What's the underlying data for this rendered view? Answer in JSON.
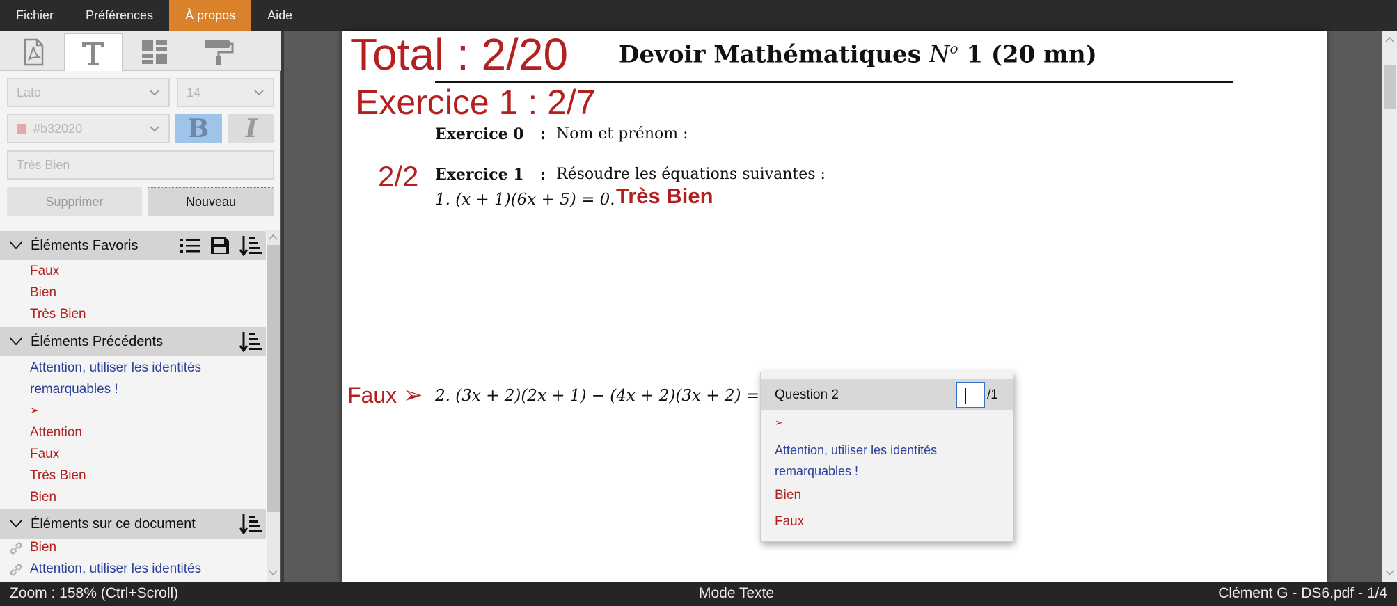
{
  "menu": {
    "file": "Fichier",
    "preferences": "Préférences",
    "about": "À propos",
    "help": "Aide"
  },
  "format": {
    "font": "Lato",
    "size": "14",
    "color": "#b32020",
    "bold_label": "B",
    "italic_label": "I",
    "text_value": "Très Bien",
    "delete_label": "Supprimer",
    "new_label": "Nouveau"
  },
  "favorites": {
    "title": "Éléments Favoris",
    "items": [
      "Faux",
      "Bien",
      "Très Bien"
    ]
  },
  "previous": {
    "title": "Éléments Précédents",
    "items": [
      "Attention, utiliser les identités remarquables !",
      "➢",
      "Attention",
      "Faux",
      "Très Bien",
      "Bien"
    ]
  },
  "document_items": {
    "title": "Éléments sur ce document",
    "items": [
      "Bien",
      "Attention, utiliser les identités"
    ]
  },
  "page": {
    "total": "Total : 2/20",
    "title": "Devoir Mathématiques",
    "title_no": "N",
    "title_o": "o",
    "title_rest": "1 (20 mn)",
    "exercise_score": "Exercice 1 : 2/7",
    "ex0_label": "Exercice 0",
    "ex0_colon": ":",
    "ex0_text": "Nom et prénom :",
    "q_score": "2/2",
    "ex1_label": "Exercice 1",
    "ex1_colon": ":",
    "ex1_text": "Résoudre les équations suivantes :",
    "eq1": "1.  (x + 1)(6x + 5) = 0.",
    "eq1_annotation": "Très Bien",
    "faux_annotation": "Faux",
    "arrow": "➢",
    "eq2": "2.  (3x + 2)(2x + 1) − (4x + 2)(3x + 2) = 0"
  },
  "popup": {
    "question": "Question 2",
    "max": "/1",
    "items": [
      "➢",
      "Attention, utiliser les identités remarquables !",
      "Bien",
      "Faux"
    ]
  },
  "status": {
    "zoom": "Zoom : 158% (Ctrl+Scroll)",
    "mode": "Mode Texte",
    "file": "Clément G - DS6.pdf - 1/4"
  },
  "colors": {
    "annotation_red": "#b32020",
    "annotation_blue": "#2a3f9a",
    "accent_orange": "#d9822b",
    "selection_blue": "#2f72c8"
  }
}
